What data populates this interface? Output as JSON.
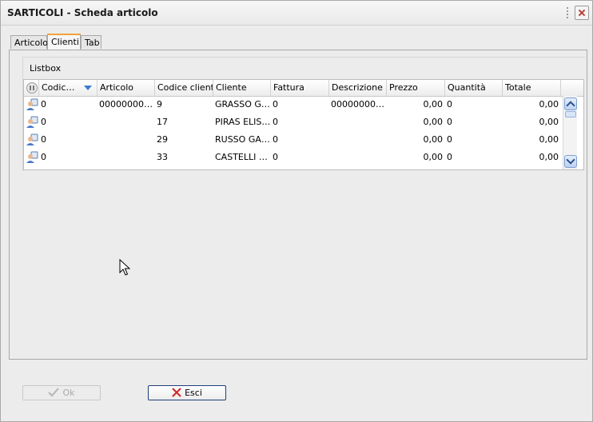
{
  "window": {
    "title": "SARTICOLI - Scheda articolo"
  },
  "tabs": [
    {
      "label": "Articolo"
    },
    {
      "label": "Clienti",
      "active": true
    },
    {
      "label": "Tab"
    }
  ],
  "listbox": {
    "label": "Listbox",
    "columns": [
      "Codic…",
      "Articolo",
      "Codice cliente",
      "Cliente",
      "Fattura",
      "Descrizione",
      "Prezzo",
      "Quantità",
      "Totale"
    ],
    "rows": [
      [
        "0",
        "000000000…",
        "9",
        "GRASSO G…",
        "0",
        "000000000…",
        "0,00",
        "0",
        "0,00"
      ],
      [
        "0",
        "",
        "17",
        "PIRAS ELIS…",
        "0",
        "",
        "0,00",
        "0",
        "0,00"
      ],
      [
        "0",
        "",
        "29",
        "RUSSO GAI…",
        "0",
        "",
        "0,00",
        "0",
        "0,00"
      ],
      [
        "0",
        "",
        "33",
        "CASTELLI …",
        "0",
        "",
        "0,00",
        "0",
        "0,00"
      ]
    ]
  },
  "buttons": {
    "ok": "Ok",
    "esci": "Esci"
  },
  "colors": {
    "active_tab_accent": "#f2a23a",
    "close_x": "#b8413a",
    "sort_arrow": "#3b7bd4",
    "esci_icon": "#d22b2b"
  }
}
